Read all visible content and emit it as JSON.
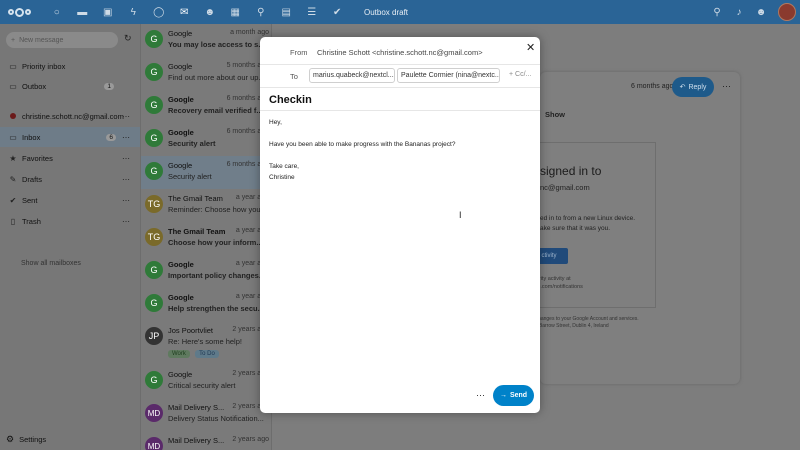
{
  "header": {
    "title": "Outbox draft",
    "apps": [
      "dashboard-icon",
      "files-icon",
      "photos-icon",
      "activity-icon",
      "talk-icon",
      "mail-icon",
      "contacts-icon",
      "calendar-icon",
      "maps-icon",
      "deck-icon",
      "tasks-icon",
      "notes-icon"
    ],
    "right_icons": [
      "search-icon",
      "notifications-icon",
      "contacts-menu-icon"
    ]
  },
  "sidebar": {
    "new_message": "New message",
    "items": [
      {
        "label": "Priority inbox",
        "icon": "inbox-icon"
      },
      {
        "label": "Outbox",
        "icon": "outbox-icon",
        "count": "1"
      },
      {
        "label": "christine.schott.nc@gmail.com",
        "icon": "account-dot"
      },
      {
        "label": "Inbox",
        "icon": "inbox-icon",
        "count": "6"
      },
      {
        "label": "Favorites",
        "icon": "star-icon"
      },
      {
        "label": "Drafts",
        "icon": "pencil-icon"
      },
      {
        "label": "Sent",
        "icon": "check-icon"
      },
      {
        "label": "Trash",
        "icon": "trash-icon"
      }
    ],
    "show_all": "Show all mailboxes",
    "settings": "Settings"
  },
  "messages": [
    {
      "initials": "G",
      "from": "Google",
      "time": "a month ago",
      "subject": "You may lose access to s...",
      "bold": true,
      "color": "#2f7a39"
    },
    {
      "initials": "G",
      "from": "Google",
      "time": "5 months ago",
      "subject": "Find out more about our up...",
      "bold": false,
      "color": "#2f7a39"
    },
    {
      "initials": "G",
      "from": "Google",
      "time": "6 months ago",
      "subject": "Recovery email verified f...",
      "bold": true,
      "color": "#2f7a39"
    },
    {
      "initials": "G",
      "from": "Google",
      "time": "6 months ago",
      "subject": "Security alert",
      "bold": true,
      "color": "#2f7a39"
    },
    {
      "initials": "G",
      "from": "Google",
      "time": "6 months ago",
      "subject": "Security alert",
      "bold": false,
      "color": "#2f7a39"
    },
    {
      "initials": "TG",
      "from": "The Gmail Team",
      "time": "a year ago",
      "subject": "Reminder: Choose how you...",
      "bold": false,
      "color": "#7a6a2a"
    },
    {
      "initials": "TG",
      "from": "The Gmail Team",
      "time": "a year ago",
      "subject": "Choose how your inform...",
      "bold": true,
      "color": "#7a6a2a"
    },
    {
      "initials": "G",
      "from": "Google",
      "time": "a year ago",
      "subject": "Important policy changes...",
      "bold": true,
      "color": "#2f7a39"
    },
    {
      "initials": "G",
      "from": "Google",
      "time": "a year ago",
      "subject": "Help strengthen the secu...",
      "bold": true,
      "color": "#2f7a39"
    },
    {
      "initials": "JP",
      "from": "Jos Poortvliet",
      "time": "2 years ago",
      "subject": "Re: Here's some help!",
      "bold": false,
      "color": "#333333",
      "tags": [
        "Work",
        "To Do"
      ]
    },
    {
      "initials": "G",
      "from": "Google",
      "time": "2 years ago",
      "subject": "Critical security alert",
      "bold": false,
      "color": "#2f7a39"
    },
    {
      "initials": "MD",
      "from": "Mail Delivery S...",
      "time": "2 years ago",
      "subject": "Delivery Status Notification...",
      "bold": false,
      "color": "#5a2a6a"
    },
    {
      "initials": "MD",
      "from": "Mail Delivery S...",
      "time": "2 years ago",
      "subject": "",
      "bold": false,
      "color": "#5a2a6a"
    }
  ],
  "background_email": {
    "time": "6 months ago",
    "reply": "Reply",
    "show": "Show",
    "title": "signed in to",
    "email": "nc@gmail.com",
    "line1": "ed in to from a new Linux device.",
    "line2": "ake sure that it was you.",
    "button": "ctivity",
    "small1": "ecurity activity at",
    "small2": "ogle.com/notifications",
    "foot1": "nt changes to your Google Account and services.",
    "foot2": "ow, Barrow Street, Dublin 4, Ireland"
  },
  "composer": {
    "from_label": "From",
    "from_value": "Christine Schott <christine.schott.nc@gmail.com>",
    "to_label": "To",
    "recipients": [
      "marius.quabeck@nextcl...",
      "Paulette Cormier (nina@nextc..."
    ],
    "cc": "+ Cc/...",
    "subject": "Checkin",
    "body": [
      "Hey,",
      "Have you been able to make progress with the Bananas project?",
      "Take care,",
      "Christine"
    ],
    "send": "Send"
  }
}
